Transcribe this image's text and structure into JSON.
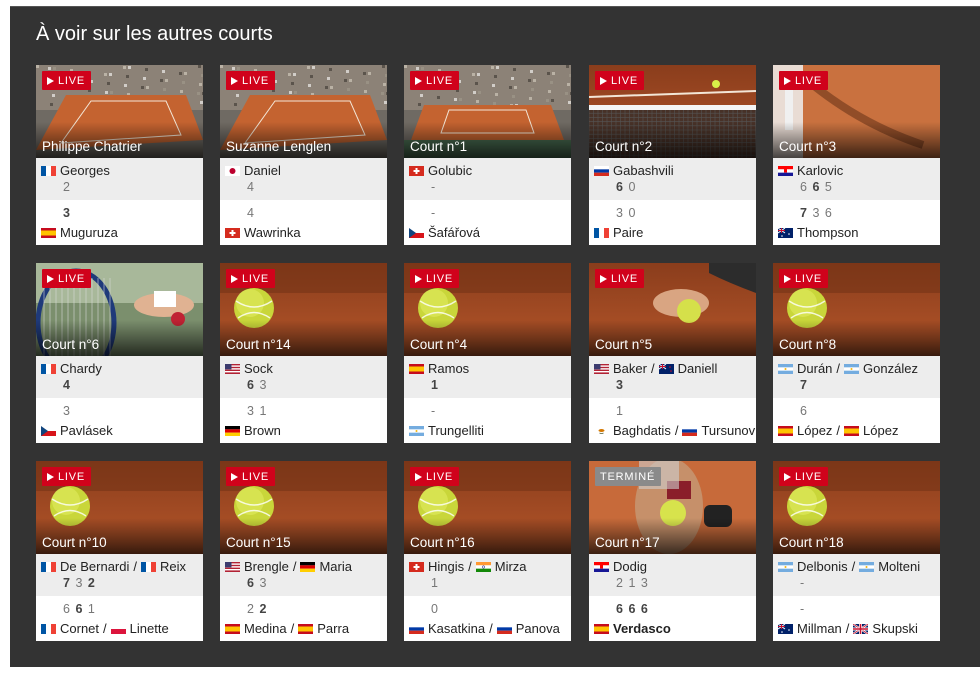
{
  "section_title": "À voir sur les autres courts",
  "colors": {
    "live_badge": "#d0021b",
    "finished_badge": "#8a8a8a",
    "panel_bg": "#333333"
  },
  "cards": [
    {
      "court": "Philippe Chatrier",
      "badge": "LIVE",
      "scene": "stadium",
      "p1": {
        "names": [
          "Georges"
        ],
        "flags": [
          "fr"
        ],
        "score": [
          {
            "v": "2",
            "w": false
          }
        ]
      },
      "p2": {
        "names": [
          "Muguruza"
        ],
        "flags": [
          "es"
        ],
        "score": [
          {
            "v": "3",
            "w": true
          }
        ]
      }
    },
    {
      "court": "Suzanne Lenglen",
      "badge": "LIVE",
      "scene": "stadium2",
      "p1": {
        "names": [
          "Daniel"
        ],
        "flags": [
          "jp"
        ],
        "score": [
          {
            "v": "4",
            "w": false
          }
        ]
      },
      "p2": {
        "names": [
          "Wawrinka"
        ],
        "flags": [
          "ch"
        ],
        "score": [
          {
            "v": "4",
            "w": false
          }
        ]
      }
    },
    {
      "court": "Court n°1",
      "badge": "LIVE",
      "scene": "court1",
      "p1": {
        "names": [
          "Golubic"
        ],
        "flags": [
          "ch"
        ],
        "score": [
          {
            "v": "-",
            "w": false
          }
        ]
      },
      "p2": {
        "names": [
          "Šafářová"
        ],
        "flags": [
          "cz"
        ],
        "score": [
          {
            "v": "-",
            "w": false
          }
        ]
      }
    },
    {
      "court": "Court n°2",
      "badge": "LIVE",
      "scene": "net",
      "p1": {
        "names": [
          "Gabashvili"
        ],
        "flags": [
          "ru"
        ],
        "score": [
          {
            "v": "6",
            "w": true
          },
          {
            "v": "0",
            "w": false
          }
        ]
      },
      "p2": {
        "names": [
          "Paire"
        ],
        "flags": [
          "fr"
        ],
        "score": [
          {
            "v": "3",
            "w": false
          },
          {
            "v": "0",
            "w": false
          }
        ]
      }
    },
    {
      "court": "Court n°3",
      "badge": "LIVE",
      "scene": "player",
      "p1": {
        "names": [
          "Karlovic"
        ],
        "flags": [
          "hr"
        ],
        "score": [
          {
            "v": "6",
            "w": false
          },
          {
            "v": "6",
            "w": true
          },
          {
            "v": "5",
            "w": false
          }
        ]
      },
      "p2": {
        "names": [
          "Thompson"
        ],
        "flags": [
          "au"
        ],
        "score": [
          {
            "v": "7",
            "w": true
          },
          {
            "v": "3",
            "w": false
          },
          {
            "v": "6",
            "w": false
          }
        ]
      }
    },
    {
      "court": "Court n°6",
      "badge": "LIVE",
      "scene": "racket",
      "p1": {
        "names": [
          "Chardy"
        ],
        "flags": [
          "fr"
        ],
        "score": [
          {
            "v": "4",
            "w": true
          }
        ]
      },
      "p2": {
        "names": [
          "Pavlásek"
        ],
        "flags": [
          "cz"
        ],
        "score": [
          {
            "v": "3",
            "w": false
          }
        ]
      }
    },
    {
      "court": "Court n°14",
      "badge": "LIVE",
      "scene": "ball",
      "p1": {
        "names": [
          "Sock"
        ],
        "flags": [
          "us"
        ],
        "score": [
          {
            "v": "6",
            "w": true
          },
          {
            "v": "3",
            "w": false
          }
        ]
      },
      "p2": {
        "names": [
          "Brown"
        ],
        "flags": [
          "de"
        ],
        "score": [
          {
            "v": "3",
            "w": false
          },
          {
            "v": "1",
            "w": false
          }
        ]
      }
    },
    {
      "court": "Court n°4",
      "badge": "LIVE",
      "scene": "ball",
      "p1": {
        "names": [
          "Ramos"
        ],
        "flags": [
          "es"
        ],
        "score": [
          {
            "v": "1",
            "w": true
          }
        ]
      },
      "p2": {
        "names": [
          "Trungelliti"
        ],
        "flags": [
          "ar"
        ],
        "score": [
          {
            "v": "-",
            "w": false
          }
        ]
      }
    },
    {
      "court": "Court n°5",
      "badge": "LIVE",
      "scene": "hand",
      "p1": {
        "names": [
          "Baker",
          "Daniell"
        ],
        "flags": [
          "us",
          "nz"
        ],
        "score": [
          {
            "v": "3",
            "w": true
          }
        ]
      },
      "p2": {
        "names": [
          "Baghdatis",
          "Tursunov"
        ],
        "flags": [
          "cy",
          "ru"
        ],
        "score": [
          {
            "v": "1",
            "w": false
          }
        ]
      }
    },
    {
      "court": "Court n°8",
      "badge": "LIVE",
      "scene": "ball",
      "p1": {
        "names": [
          "Durán",
          "González"
        ],
        "flags": [
          "ar",
          "ar"
        ],
        "score": [
          {
            "v": "7",
            "w": true
          }
        ]
      },
      "p2": {
        "names": [
          "López",
          "López"
        ],
        "flags": [
          "es",
          "es"
        ],
        "score": [
          {
            "v": "6",
            "w": false
          }
        ]
      }
    },
    {
      "court": "Court n°10",
      "badge": "LIVE",
      "scene": "ball",
      "p1": {
        "names": [
          "De Bernardi",
          "Reix"
        ],
        "flags": [
          "fr",
          "fr"
        ],
        "score": [
          {
            "v": "7",
            "w": true
          },
          {
            "v": "3",
            "w": false
          },
          {
            "v": "2",
            "w": true
          }
        ]
      },
      "p2": {
        "names": [
          "Cornet",
          "Linette"
        ],
        "flags": [
          "fr",
          "pl"
        ],
        "score": [
          {
            "v": "6",
            "w": false
          },
          {
            "v": "6",
            "w": true
          },
          {
            "v": "1",
            "w": false
          }
        ]
      }
    },
    {
      "court": "Court n°15",
      "badge": "LIVE",
      "scene": "ball",
      "p1": {
        "names": [
          "Brengle",
          "Maria"
        ],
        "flags": [
          "us",
          "de"
        ],
        "score": [
          {
            "v": "6",
            "w": true
          },
          {
            "v": "3",
            "w": false
          }
        ]
      },
      "p2": {
        "names": [
          "Medina",
          "Parra"
        ],
        "flags": [
          "es",
          "es"
        ],
        "score": [
          {
            "v": "2",
            "w": false
          },
          {
            "v": "2",
            "w": true
          }
        ]
      }
    },
    {
      "court": "Court n°16",
      "badge": "LIVE",
      "scene": "ball",
      "p1": {
        "names": [
          "Hingis",
          "Mirza"
        ],
        "flags": [
          "ch",
          "in"
        ],
        "score": [
          {
            "v": "1",
            "w": false
          }
        ]
      },
      "p2": {
        "names": [
          "Kasatkina",
          "Panova"
        ],
        "flags": [
          "ru",
          "ru"
        ],
        "score": [
          {
            "v": "0",
            "w": false
          }
        ]
      }
    },
    {
      "court": "Court n°17",
      "badge": "TERMINÉ",
      "scene": "serve",
      "p1": {
        "names": [
          "Dodig"
        ],
        "flags": [
          "hr"
        ],
        "score": [
          {
            "v": "2",
            "w": false
          },
          {
            "v": "1",
            "w": false
          },
          {
            "v": "3",
            "w": false
          }
        ]
      },
      "p2": {
        "names": [
          "Verdasco"
        ],
        "flags": [
          "es"
        ],
        "winner": true,
        "score": [
          {
            "v": "6",
            "w": true
          },
          {
            "v": "6",
            "w": true
          },
          {
            "v": "6",
            "w": true
          }
        ]
      }
    },
    {
      "court": "Court n°18",
      "badge": "LIVE",
      "scene": "ball",
      "p1": {
        "names": [
          "Delbonis",
          "Molteni"
        ],
        "flags": [
          "ar",
          "ar"
        ],
        "score": [
          {
            "v": "-",
            "w": false
          }
        ]
      },
      "p2": {
        "names": [
          "Millman",
          "Skupski"
        ],
        "flags": [
          "au",
          "gb"
        ],
        "score": [
          {
            "v": "-",
            "w": false
          }
        ]
      }
    }
  ]
}
